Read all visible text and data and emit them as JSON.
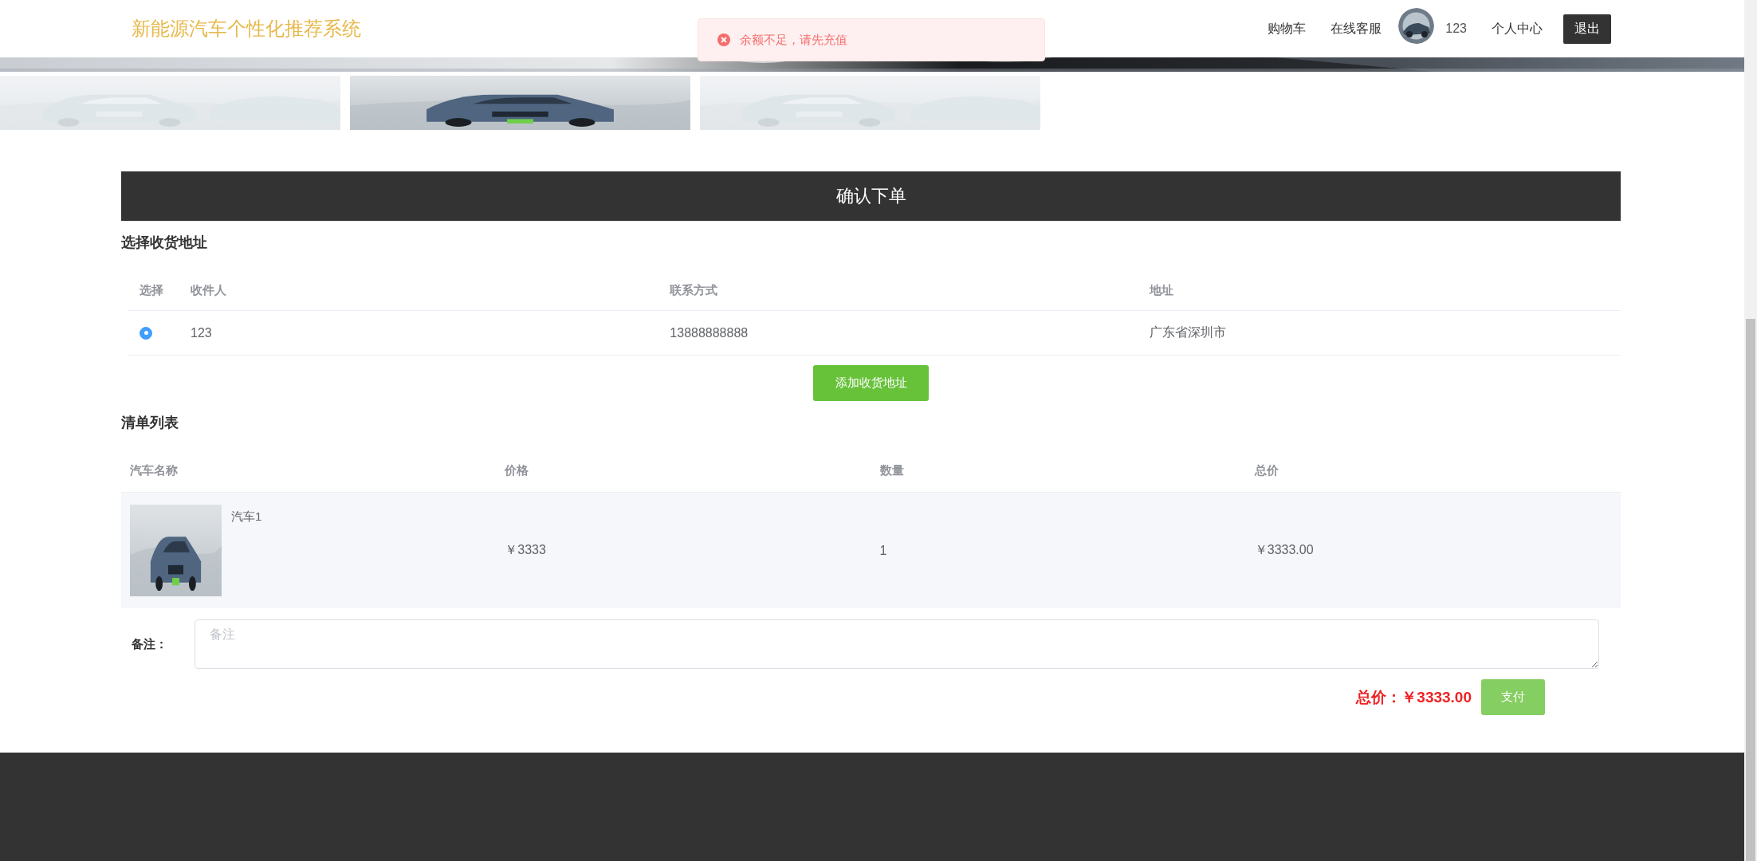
{
  "header": {
    "title": "新能源汽车个性化推荐系统",
    "nav": [
      {
        "label": "购物车"
      },
      {
        "label": "在线客服"
      }
    ],
    "username": "123",
    "profile": "个人中心",
    "logout": "退出"
  },
  "toast": {
    "kind": "error",
    "message": "余额不足，请先充值"
  },
  "carousel": {
    "slides": [
      {
        "kind": "picture",
        "selected": false
      },
      {
        "kind": "picture",
        "selected": true
      },
      {
        "kind": "picture",
        "selected": false
      }
    ]
  },
  "order": {
    "title": "确认下单",
    "address_section": "选择收货地址",
    "address_table": {
      "columns": [
        "选择",
        "收件人",
        "联系方式",
        "地址"
      ],
      "rows": [
        {
          "selected": true,
          "name": "123",
          "phone": "13888888888",
          "address": "广东省深圳市"
        }
      ]
    },
    "add_address": "添加收货地址",
    "list_section": "清单列表",
    "items_table": {
      "columns": [
        "汽车名称",
        "价格",
        "数量",
        "总价"
      ],
      "rows": [
        {
          "name": "汽车1",
          "price": "￥3333",
          "quantity": "1",
          "total": "￥3333.00"
        }
      ]
    },
    "remark": {
      "label": "备注：",
      "placeholder": "备注"
    },
    "total": "总价：￥3333.00",
    "pay": "支付"
  }
}
